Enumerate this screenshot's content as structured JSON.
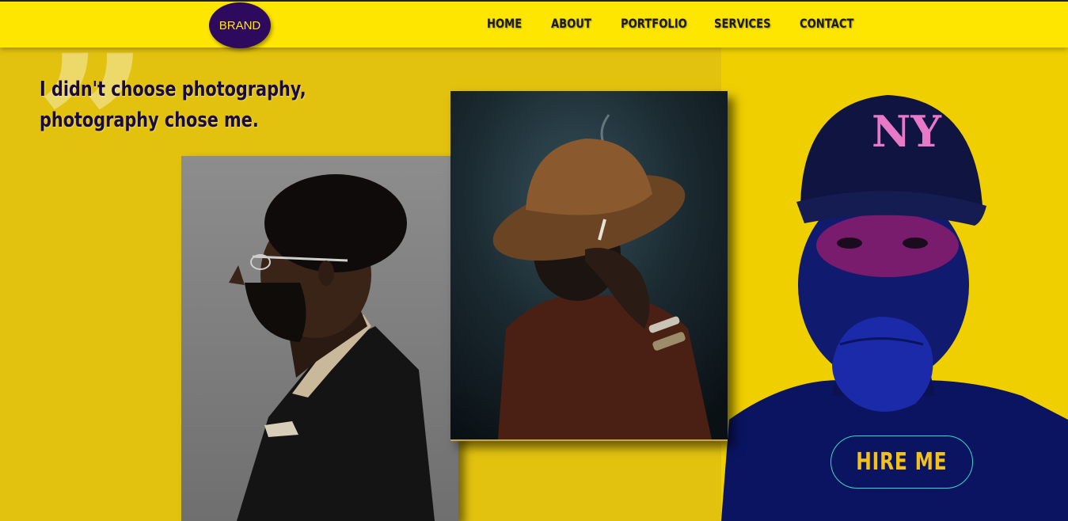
{
  "brand": {
    "label": "BRAND"
  },
  "nav": {
    "items": [
      {
        "label": "HOME"
      },
      {
        "label": "ABOUT"
      },
      {
        "label": "PORTFOLIO"
      },
      {
        "label": "SERVICES"
      },
      {
        "label": "CONTACT"
      }
    ]
  },
  "hero": {
    "quote_mark": "”",
    "quote_line_1": "I didn't choose photography,",
    "quote_line_2": "photography chose me.",
    "cta_label": "HIRE ME"
  },
  "colors": {
    "navbar": "#ffe600",
    "background": "#e2c20f",
    "brand_circle": "#2e0a5e",
    "cta_border": "#3ad6c8",
    "cta_text": "#f2c21a",
    "quote_text": "#1a0b3d"
  },
  "icons": {
    "quote": "quote-mark-icon"
  }
}
